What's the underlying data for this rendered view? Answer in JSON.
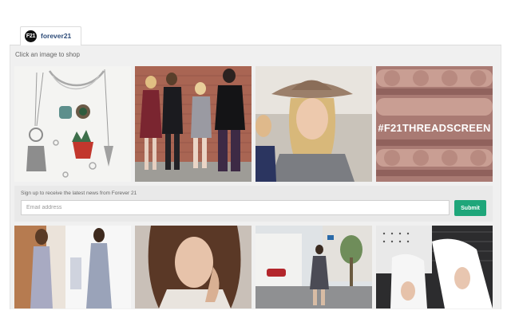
{
  "brand": {
    "logo_text": "F21",
    "name": "forever21"
  },
  "hint": "Click an image to shop",
  "tiles": [
    {
      "name": "jewelry-flatlay"
    },
    {
      "name": "brick-wall-group"
    },
    {
      "name": "fedora-portrait"
    },
    {
      "name": "threadscreen-promo",
      "overlay_text": "#F21THREADSCREEN"
    },
    {
      "name": "dress-duo"
    },
    {
      "name": "closeup-portrait"
    },
    {
      "name": "street-style"
    },
    {
      "name": "white-sneakers"
    }
  ],
  "signup": {
    "label": "Sign up to receive the latest news from Forever 21",
    "placeholder": "Email address",
    "submit_label": "Submit"
  },
  "colors": {
    "submit": "#1fa67a",
    "brand_text": "#2d4b78"
  }
}
